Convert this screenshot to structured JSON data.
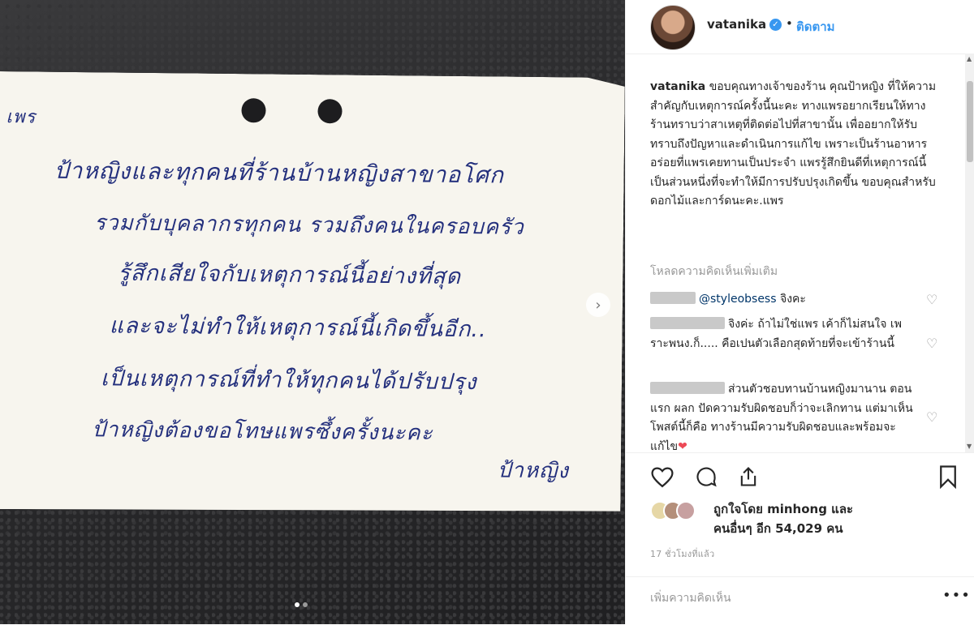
{
  "photo": {
    "handwriting": [
      "เพร",
      "ป้าหญิงและทุกคนที่ร้านบ้านหญิงสาขาอโศก",
      "รวมกับบุคลากรทุกคน รวมถึงคนในครอบครัว",
      "รู้สึกเสียใจกับเหตุการณ์นี้อย่างที่สุด",
      "และจะไม่ทำให้เหตุการณ์นี้เกิดขึ้นอีก..",
      "เป็นเหตุการณ์ที่ทำให้ทุกคนได้ปรับปรุง",
      "ป้าหญิงต้องขอโทษแพรซึ้งครั้งนะคะ",
      "ป้าหญิง"
    ]
  },
  "post": {
    "username": "vatanika",
    "follow_label": "ติดตาม",
    "separator": "•",
    "caption_user": "vatanika",
    "caption": "ขอบคุณทางเจ้าของร้าน คุณป้าหญิง ที่ให้ความสำคัญกับเหตุการณ์ครั้งนี้นะคะ ทางแพรอยากเรียนให้ทางร้านทราบว่าสาเหตุที่ติดต่อไปที่สาขานั้น เพื่ออยากให้รับทราบถึงปัญหาและดำเนินการแก้ไข เพราะเป็นร้านอาหารอร่อยที่แพรเคยทานเป็นประจำ แพรรู้สึกยินดีที่เหตุการณ์นี้เป็นส่วนหนึ่งที่จะทำให้มีการปรับปรุงเกิดขึ้น ขอบคุณสำหรับดอกไม้และการ์ดนะคะ.แพร",
    "load_more": "โหลดความคิดเห็นเพิ่มเติม",
    "comments": [
      {
        "mention": "@styleobsess",
        "text": "จิงคะ"
      },
      {
        "mention": "",
        "text": "จิงค่ะ ถ้าไม่ใช่แพร เค้าก็ไม่สนใจ เพราะพนง.ก็..... คือเปนตัวเลือกสุดท้ายที่จะเข้าร้านนี้"
      },
      {
        "mention": "",
        "text": "ส่วนตัวชอบทานบ้านหญิงมานาน ตอนแรก ผลก ปัดความรับผิดชอบก็ว่าจะเลิกทาน แต่มาเห็นโพสต์นี้ก็คือ ทางร้านมีความรับผิดชอบและพร้อมจะแก้ไข"
      }
    ],
    "liked_by": "ถูกใจโดย minhong และ",
    "liked_others": "คนอื่นๆ อีก 54,029 คน",
    "timestamp": "17 ชั่วโมงที่แล้ว",
    "add_comment_placeholder": "เพิ่มความคิดเห็น",
    "more_options": "•••"
  },
  "icons": {
    "like": "heart-icon",
    "comment": "comment-bubble-icon",
    "share": "share-icon",
    "save": "bookmark-icon",
    "next": "chevron-right-icon",
    "verified": "verified-badge-icon"
  },
  "colors": {
    "accent": "#3897f0",
    "text": "#262626",
    "muted": "#999999",
    "heart": "#ed4956"
  },
  "carousel": {
    "count": 2,
    "active": 1
  }
}
